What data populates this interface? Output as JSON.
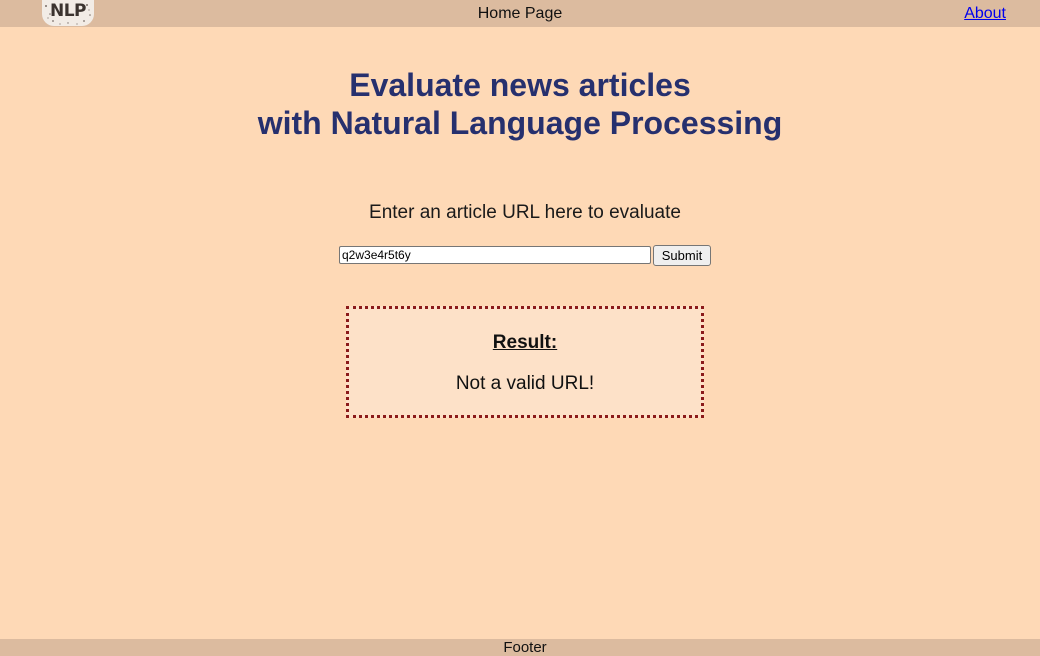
{
  "header": {
    "logo_text": "NLP",
    "title": "Home Page",
    "about_link": "About"
  },
  "main": {
    "headline_line1": "Evaluate news articles",
    "headline_line2": "with Natural Language Processing",
    "prompt": "Enter an article URL here to evaluate",
    "url_input_value": "q2w3e4r5t6y",
    "submit_label": "Submit"
  },
  "result": {
    "heading": "Result:",
    "message": "Not a valid URL!"
  },
  "footer": {
    "text": "Footer"
  },
  "colors": {
    "page_background": "#fed9b6",
    "header_background": "#dcbb9f",
    "headline": "#26306e",
    "result_border": "#8b1a1a",
    "link": "#0000ee"
  }
}
